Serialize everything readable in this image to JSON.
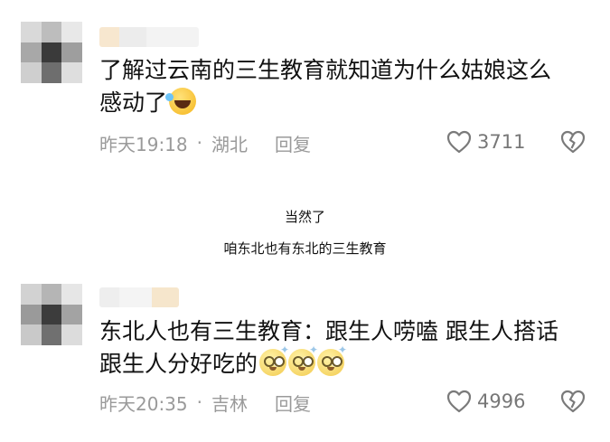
{
  "comments": [
    {
      "text_line1": "了解过云南的三生教育就知道为什么姑娘这么",
      "text_line2": "感动了",
      "emoji": "laughing-tears-emoji",
      "time": "昨天19:18",
      "separator": "·",
      "location": "湖北",
      "reply_label": "回复",
      "likes": "3711"
    },
    {
      "text_line1": "东北人也有三生教育：跟生人唠嗑 跟生人搭话",
      "text_line2": "跟生人分好吃的",
      "emoji": "dizzy-face-emoji",
      "time": "昨天20:35",
      "separator": "·",
      "location": "吉林",
      "reply_label": "回复",
      "likes": "4996"
    }
  ],
  "captions": {
    "line1": "当然了",
    "line2": "咱东北也有东北的三生教育"
  },
  "icons": {
    "like": "heart-outline-icon",
    "dislike": "broken-heart-icon"
  },
  "colors": {
    "text": "#111111",
    "meta": "#9a9a9a",
    "icon": "#7a7a7a"
  }
}
